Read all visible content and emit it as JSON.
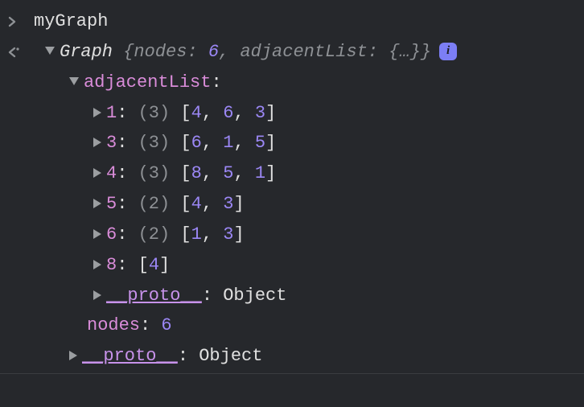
{
  "input_expression": "myGraph",
  "object": {
    "class_name": "Graph",
    "summary": {
      "prefix": "{",
      "props": [
        {
          "key": "nodes",
          "value": "6"
        },
        {
          "key": "adjacentList",
          "value": "{…}"
        }
      ],
      "suffix": "}"
    },
    "adjacentList": {
      "label": "adjacentList",
      "colon": ":",
      "entries": [
        {
          "key": "1",
          "count": "(3)",
          "values": [
            "4",
            "6",
            "3"
          ]
        },
        {
          "key": "3",
          "count": "(3)",
          "values": [
            "6",
            "1",
            "5"
          ]
        },
        {
          "key": "4",
          "count": "(3)",
          "values": [
            "8",
            "5",
            "1"
          ]
        },
        {
          "key": "5",
          "count": "(2)",
          "values": [
            "4",
            "3"
          ]
        },
        {
          "key": "6",
          "count": "(2)",
          "values": [
            "1",
            "3"
          ]
        },
        {
          "key": "8",
          "count": null,
          "values": [
            "4"
          ]
        }
      ],
      "proto": {
        "label": "__proto__",
        "value": "Object"
      }
    },
    "nodes_prop": {
      "key": "nodes",
      "value": "6"
    },
    "proto": {
      "label": "__proto__",
      "value": "Object"
    }
  },
  "punct": {
    "open_bracket": "[",
    "close_bracket": "]",
    "comma": ", ",
    "colon": ": "
  }
}
